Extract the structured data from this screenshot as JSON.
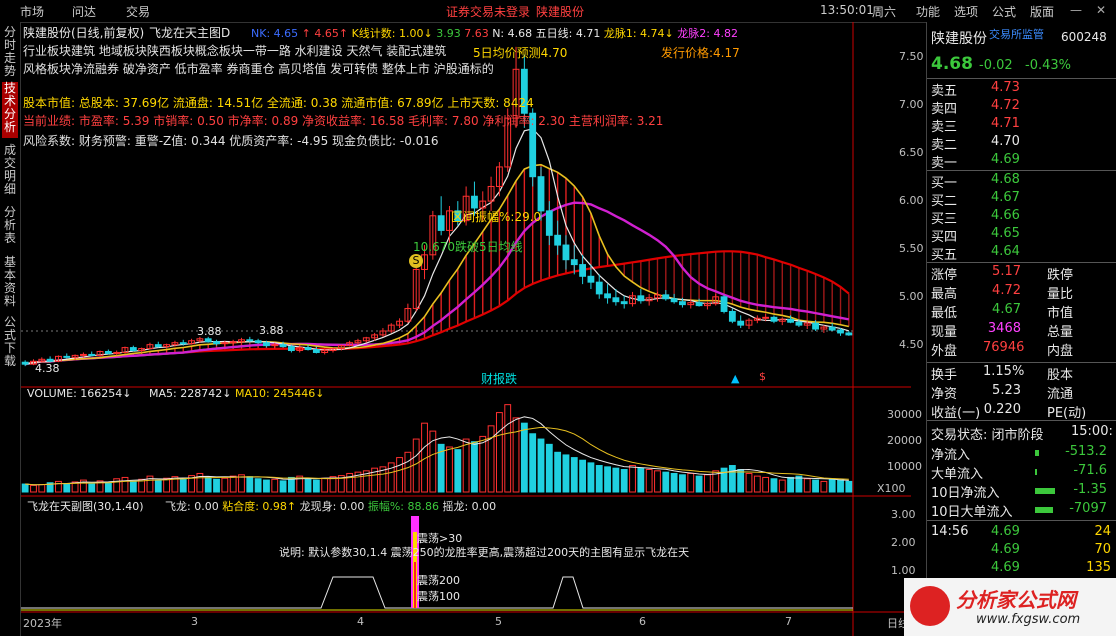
{
  "menu": {
    "market": "市场",
    "ask": "问达",
    "trade": "交易",
    "center_notice": "证券交易未登录",
    "center_name": "陕建股份",
    "time": "13:50:01",
    "weekday": "周六",
    "right": [
      "功能",
      "选项",
      "公式",
      "版面"
    ]
  },
  "leftnav": [
    "分时走势",
    "技术分析",
    "成交明细",
    "分析表",
    "基本资料",
    "公式下载"
  ],
  "chart": {
    "title": "陕建股份(日线,前复权)",
    "indicator": "飞龙在天主图D",
    "top_values": [
      {
        "t": "NK: 4.65",
        "c": "#3b6cff"
      },
      {
        "t": "↑",
        "c": "#ff4040"
      },
      {
        "t": "4.65↑",
        "c": "#ff4040"
      },
      {
        "t": "K线计数: 1.00↓",
        "c": "#ffd700"
      },
      {
        "t": "3.93",
        "c": "#3cc83c"
      },
      {
        "t": "7.63",
        "c": "#ff4040"
      },
      {
        "t": "N: 4.68",
        "c": "#e8e8e8"
      },
      {
        "t": "五日线: 4.71",
        "c": "#e8e8e8"
      },
      {
        "t": "龙脉1: 4.74↓",
        "c": "#ffd700"
      },
      {
        "t": "龙脉2: 4.82",
        "c": "#ff40ff"
      }
    ],
    "info_lines": [
      {
        "t": "行业板块建筑    地域板块陕西板块概念板块一带一路 水利建设 天然气 装配式建筑",
        "c": "#e0e0e0"
      },
      {
        "t": "风格板块净流融券 破净资产 低市盈率 券商重仓 高贝塔值 发可转债 整体上市 沪股通标的",
        "c": "#e0e0e0"
      },
      {
        "t": "股本市值: 总股本: 37.69亿 流通盘: 14.51亿 全流通: 0.38 流通市值: 67.89亿 上市天数: 8424",
        "c": "#ffd700"
      },
      {
        "t": "当前业绩: 市盈率: 5.39 市销率: 0.50 市净率: 0.89 净资收益率: 16.58 毛利率: 7.80 净利润率: 2.30 主营利润率: 3.21",
        "c": "#ff4040"
      },
      {
        "t": "风险系数: 财务预警: 重警-Z值: 0.344 优质资产率: -4.95 现金负债比: -0.016",
        "c": "#e0e0e0"
      }
    ],
    "annot_5day": "5日均价预测4.70",
    "annot_issue": "发行价格:4.17",
    "annot_range": "区间振幅%:29.0",
    "annot_cross": "10.670跌破5日均线",
    "annot_s": "S",
    "annot_388a": "3.88",
    "annot_388b": "3.88",
    "annot_438": "4.38",
    "annot_event": "财报跌",
    "price_ticks": [
      "7.50",
      "7.00",
      "6.50",
      "6.00",
      "5.50",
      "5.00",
      "4.50"
    ],
    "volume_title": "VOLUME: 166254↓",
    "ma5": "MA5: 228742↓",
    "ma10": "MA10: 245446↓",
    "vol_ticks": [
      "30000",
      "20000",
      "10000"
    ],
    "vol_unit": "X100",
    "sub_title": "飞龙在天副图(30,1.40)",
    "sub_values": [
      {
        "t": "飞龙: 0.00",
        "c": "#e0e0e0"
      },
      {
        "t": "粘合度: 0.98↑",
        "c": "#ffd700"
      },
      {
        "t": "龙现身: 0.00",
        "c": "#e0e0e0"
      },
      {
        "t": "振幅%: 88.86",
        "c": "#3cc83c"
      },
      {
        "t": "摇龙: 0.00",
        "c": "#e0e0e0"
      }
    ],
    "sub_ticks": [
      "3.00",
      "2.00",
      "1.00"
    ],
    "sub_label_30": "震荡>30",
    "sub_desc": "说明: 默认参数30,1.4 震荡250的龙胜率更高,震荡超过200天的主图有显示飞龙在天",
    "sub_label_200": "震荡200",
    "sub_label_100": "震荡100",
    "x_labels": [
      "2023年",
      "3",
      "4",
      "5",
      "6",
      "7"
    ],
    "x_right": "日线"
  },
  "quote": {
    "name": "陕建股份",
    "tag": "交易所监管",
    "code": "600248",
    "price": "4.68",
    "change": "-0.02",
    "pct": "-0.43%",
    "asks": [
      {
        "l": "卖五",
        "p": "4.73"
      },
      {
        "l": "卖四",
        "p": "4.72"
      },
      {
        "l": "卖三",
        "p": "4.71"
      },
      {
        "l": "卖二",
        "p": "4.70"
      },
      {
        "l": "卖一",
        "p": "4.69"
      }
    ],
    "bids": [
      {
        "l": "买一",
        "p": "4.68"
      },
      {
        "l": "买二",
        "p": "4.67"
      },
      {
        "l": "买三",
        "p": "4.66"
      },
      {
        "l": "买四",
        "p": "4.65"
      },
      {
        "l": "买五",
        "p": "4.64"
      }
    ],
    "stats": [
      {
        "l": "涨停",
        "v": "5.17",
        "vc": "#ff4040",
        "r": "跌停"
      },
      {
        "l": "最高",
        "v": "4.72",
        "vc": "#ff4040",
        "r": "量比"
      },
      {
        "l": "最低",
        "v": "4.67",
        "vc": "#3cc83c",
        "r": "市值"
      },
      {
        "l": "现量",
        "v": "3468",
        "vc": "#ff40ff",
        "r": "总量"
      },
      {
        "l": "外盘",
        "v": "76946",
        "vc": "#ff4040",
        "r": "内盘"
      }
    ],
    "stats2": [
      {
        "l": "换手",
        "v": "1.15%",
        "r": "股本"
      },
      {
        "l": "净资",
        "v": "5.23",
        "r": "流通"
      },
      {
        "l": "收益(一)",
        "v": "0.220",
        "r": "PE(动)"
      }
    ],
    "status_label": "交易状态: 闭市阶段",
    "status_time": "15:00:",
    "flows": [
      {
        "l": "净流入",
        "v": "-513.2",
        "bar": 0.1
      },
      {
        "l": "大单流入",
        "v": "-71.6",
        "bar": 0.05
      },
      {
        "l": "10日净流入",
        "v": "-1.35",
        "bar": 0.55
      },
      {
        "l": "10日大单流入",
        "v": "-7097",
        "bar": 0.5
      }
    ],
    "ticks": [
      {
        "time": "14:56",
        "p": "4.69",
        "v": "24"
      },
      {
        "time": "",
        "p": "4.69",
        "v": "70"
      },
      {
        "time": "",
        "p": "4.69",
        "v": "135"
      }
    ]
  },
  "watermark": "分析家公式网",
  "watermark_url": "www.fxgsw.com",
  "chart_data": {
    "type": "candlestick",
    "price_range": [
      4.3,
      7.7
    ],
    "candles": [
      [
        4.4,
        4.42,
        4.36,
        4.38
      ],
      [
        4.38,
        4.43,
        4.37,
        4.41
      ],
      [
        4.41,
        4.45,
        4.4,
        4.43
      ],
      [
        4.43,
        4.46,
        4.4,
        4.41
      ],
      [
        4.41,
        4.47,
        4.4,
        4.46
      ],
      [
        4.46,
        4.49,
        4.44,
        4.45
      ],
      [
        4.45,
        4.48,
        4.42,
        4.47
      ],
      [
        4.47,
        4.5,
        4.45,
        4.48
      ],
      [
        4.48,
        4.51,
        4.46,
        4.47
      ],
      [
        4.47,
        4.52,
        4.46,
        4.51
      ],
      [
        4.51,
        4.53,
        4.48,
        4.49
      ],
      [
        4.49,
        4.52,
        4.47,
        4.5
      ],
      [
        4.5,
        4.56,
        4.49,
        4.55
      ],
      [
        4.55,
        4.57,
        4.51,
        4.52
      ],
      [
        4.52,
        4.55,
        4.5,
        4.54
      ],
      [
        4.54,
        4.6,
        4.53,
        4.58
      ],
      [
        4.58,
        4.61,
        4.55,
        4.56
      ],
      [
        4.56,
        4.59,
        4.54,
        4.58
      ],
      [
        4.58,
        4.62,
        4.56,
        4.6
      ],
      [
        4.6,
        4.63,
        4.57,
        4.59
      ],
      [
        4.59,
        4.64,
        4.58,
        4.62
      ],
      [
        4.62,
        4.66,
        4.6,
        4.64
      ],
      [
        4.64,
        4.66,
        4.6,
        4.61
      ],
      [
        4.61,
        4.63,
        4.57,
        4.59
      ],
      [
        4.59,
        4.62,
        4.56,
        4.6
      ],
      [
        4.6,
        4.63,
        4.58,
        4.61
      ],
      [
        4.61,
        4.65,
        4.6,
        4.63
      ],
      [
        4.63,
        4.66,
        4.6,
        4.62
      ],
      [
        4.62,
        4.64,
        4.59,
        4.6
      ],
      [
        4.6,
        4.62,
        4.55,
        4.57
      ],
      [
        4.57,
        4.6,
        4.54,
        4.58
      ],
      [
        4.58,
        4.61,
        4.55,
        4.56
      ],
      [
        4.56,
        4.58,
        4.5,
        4.52
      ],
      [
        4.52,
        4.56,
        4.5,
        4.55
      ],
      [
        4.55,
        4.58,
        4.52,
        4.53
      ],
      [
        4.53,
        4.56,
        4.49,
        4.5
      ],
      [
        4.5,
        4.54,
        4.48,
        4.52
      ],
      [
        4.52,
        4.55,
        4.5,
        4.54
      ],
      [
        4.54,
        4.58,
        4.52,
        4.57
      ],
      [
        4.57,
        4.62,
        4.56,
        4.6
      ],
      [
        4.6,
        4.64,
        4.58,
        4.62
      ],
      [
        4.62,
        4.66,
        4.6,
        4.65
      ],
      [
        4.65,
        4.7,
        4.62,
        4.68
      ],
      [
        4.68,
        4.75,
        4.66,
        4.72
      ],
      [
        4.72,
        4.8,
        4.7,
        4.78
      ],
      [
        4.78,
        4.85,
        4.75,
        4.82
      ],
      [
        4.82,
        5.0,
        4.8,
        4.95
      ],
      [
        4.95,
        5.4,
        4.92,
        5.35
      ],
      [
        5.35,
        5.6,
        5.25,
        5.5
      ],
      [
        5.5,
        5.95,
        5.45,
        5.9
      ],
      [
        5.9,
        6.1,
        5.7,
        5.75
      ],
      [
        5.75,
        6.0,
        5.6,
        5.95
      ],
      [
        5.95,
        6.05,
        5.8,
        5.85
      ],
      [
        5.85,
        6.2,
        5.8,
        6.1
      ],
      [
        6.1,
        6.25,
        5.9,
        5.98
      ],
      [
        5.98,
        6.15,
        5.85,
        6.05
      ],
      [
        6.05,
        6.3,
        5.95,
        6.2
      ],
      [
        6.2,
        6.45,
        6.1,
        6.4
      ],
      [
        6.4,
        7.0,
        6.35,
        6.9
      ],
      [
        6.9,
        7.63,
        6.8,
        7.4
      ],
      [
        7.4,
        7.55,
        6.8,
        6.95
      ],
      [
        6.95,
        7.0,
        6.2,
        6.3
      ],
      [
        6.3,
        6.4,
        5.85,
        5.95
      ],
      [
        5.95,
        6.05,
        5.6,
        5.7
      ],
      [
        5.7,
        5.85,
        5.5,
        5.6
      ],
      [
        5.6,
        5.7,
        5.35,
        5.45
      ],
      [
        5.45,
        5.6,
        5.3,
        5.4
      ],
      [
        5.4,
        5.5,
        5.2,
        5.28
      ],
      [
        5.28,
        5.4,
        5.15,
        5.22
      ],
      [
        5.22,
        5.3,
        5.05,
        5.1
      ],
      [
        5.1,
        5.2,
        5.0,
        5.06
      ],
      [
        5.06,
        5.15,
        4.98,
        5.02
      ],
      [
        5.02,
        5.08,
        4.95,
        5.0
      ],
      [
        5.0,
        5.12,
        4.97,
        5.08
      ],
      [
        5.08,
        5.15,
        5.0,
        5.03
      ],
      [
        5.03,
        5.1,
        4.98,
        5.06
      ],
      [
        5.06,
        5.12,
        5.02,
        5.09
      ],
      [
        5.09,
        5.14,
        5.03,
        5.05
      ],
      [
        5.05,
        5.1,
        5.0,
        5.02
      ],
      [
        5.02,
        5.06,
        4.96,
        4.99
      ],
      [
        4.99,
        5.04,
        4.95,
        5.01
      ],
      [
        5.01,
        5.05,
        4.97,
        4.98
      ],
      [
        4.98,
        5.02,
        4.94,
        5.0
      ],
      [
        5.0,
        5.1,
        4.98,
        5.07
      ],
      [
        5.07,
        5.09,
        4.9,
        4.92
      ],
      [
        4.92,
        4.95,
        4.8,
        4.82
      ],
      [
        4.82,
        4.88,
        4.75,
        4.78
      ],
      [
        4.78,
        4.85,
        4.74,
        4.83
      ],
      [
        4.83,
        4.88,
        4.8,
        4.85
      ],
      [
        4.85,
        4.9,
        4.82,
        4.86
      ],
      [
        4.86,
        4.88,
        4.8,
        4.82
      ],
      [
        4.82,
        4.86,
        4.78,
        4.84
      ],
      [
        4.84,
        4.88,
        4.8,
        4.81
      ],
      [
        4.81,
        4.84,
        4.76,
        4.78
      ],
      [
        4.78,
        4.82,
        4.74,
        4.8
      ],
      [
        4.8,
        4.83,
        4.72,
        4.74
      ],
      [
        4.74,
        4.78,
        4.7,
        4.76
      ],
      [
        4.76,
        4.8,
        4.72,
        4.73
      ],
      [
        4.73,
        4.75,
        4.67,
        4.7
      ],
      [
        4.7,
        4.72,
        4.67,
        4.68
      ]
    ],
    "volumes": [
      30,
      25,
      28,
      35,
      40,
      32,
      38,
      45,
      30,
      42,
      36,
      50,
      55,
      40,
      48,
      60,
      45,
      52,
      58,
      50,
      62,
      70,
      55,
      48,
      52,
      60,
      65,
      58,
      50,
      45,
      48,
      42,
      55,
      60,
      50,
      45,
      52,
      58,
      62,
      70,
      75,
      80,
      90,
      95,
      110,
      130,
      150,
      200,
      260,
      230,
      180,
      170,
      160,
      200,
      190,
      210,
      250,
      300,
      330,
      280,
      260,
      220,
      200,
      180,
      150,
      140,
      130,
      120,
      110,
      100,
      95,
      90,
      85,
      100,
      90,
      85,
      80,
      75,
      70,
      65,
      70,
      60,
      65,
      80,
      90,
      100,
      85,
      70,
      60,
      55,
      50,
      45,
      55,
      60,
      50,
      45,
      40,
      50,
      45,
      40
    ],
    "vol_range": [
      0,
      340
    ]
  }
}
